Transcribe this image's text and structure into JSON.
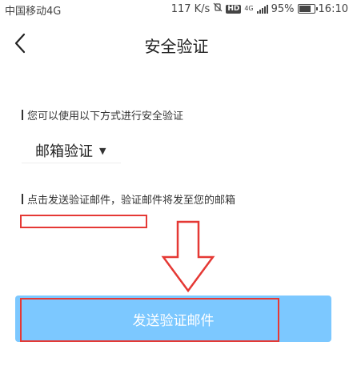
{
  "status_bar": {
    "carrier": "中国移动4G",
    "speed": "117 K/s",
    "mute_icon": "vibrate-mute-icon",
    "hd_icon_label": "HD",
    "net_icon_label": "4G",
    "battery_percent": "95%",
    "time": "16:10"
  },
  "header": {
    "back_icon": "chevron-left-icon",
    "title": "安全验证"
  },
  "verification": {
    "methods_hint": "您可以使用以下方式进行安全验证",
    "method_selected": "邮箱验证",
    "dropdown_icon": "caret-down-icon",
    "send_hint": "点击发送验证邮件，验证邮件将发至您的邮箱",
    "email_value": ""
  },
  "actions": {
    "send_label": "发送验证邮件"
  },
  "colors": {
    "primary_button": "#7cc8ff",
    "annotation_red": "#e53935"
  }
}
